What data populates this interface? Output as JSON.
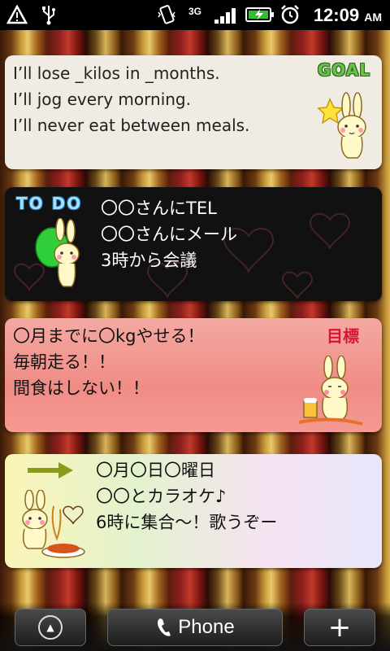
{
  "status_bar": {
    "time": "12:09",
    "ampm": "AM",
    "network_label": "3G",
    "icons": [
      "warning-icon",
      "usb-icon",
      "vibrate-icon",
      "signal-icon",
      "battery-charging-icon",
      "alarm-clock-icon"
    ]
  },
  "widgets": {
    "goal": {
      "badge": "GOAL",
      "lines": [
        "I’ll lose _kilos in _months.",
        "I’ll jog every morning.",
        "I’ll never eat between meals."
      ]
    },
    "todo": {
      "badge": "TO DO",
      "lines": [
        "〇〇さんにTEL",
        "〇〇さんにメール",
        "3時から会議"
      ]
    },
    "mokuhyo": {
      "badge": "目標",
      "lines": [
        "〇月までに〇kgやせる！",
        "毎朝走る！！",
        "間食はしない！！"
      ]
    },
    "karaoke": {
      "lines": [
        "〇月〇日〇曜日",
        "〇〇とカラオケ♪",
        "6時に集合～！歌うぞー"
      ]
    }
  },
  "dock": {
    "phone_label": "Phone",
    "add_label": "+"
  },
  "colors": {
    "goal_badge": "#6ac04a",
    "todo_badge": "#9fe0ff",
    "mokuhyo_badge": "#d8143a",
    "arrow": "#8a9a1a"
  }
}
